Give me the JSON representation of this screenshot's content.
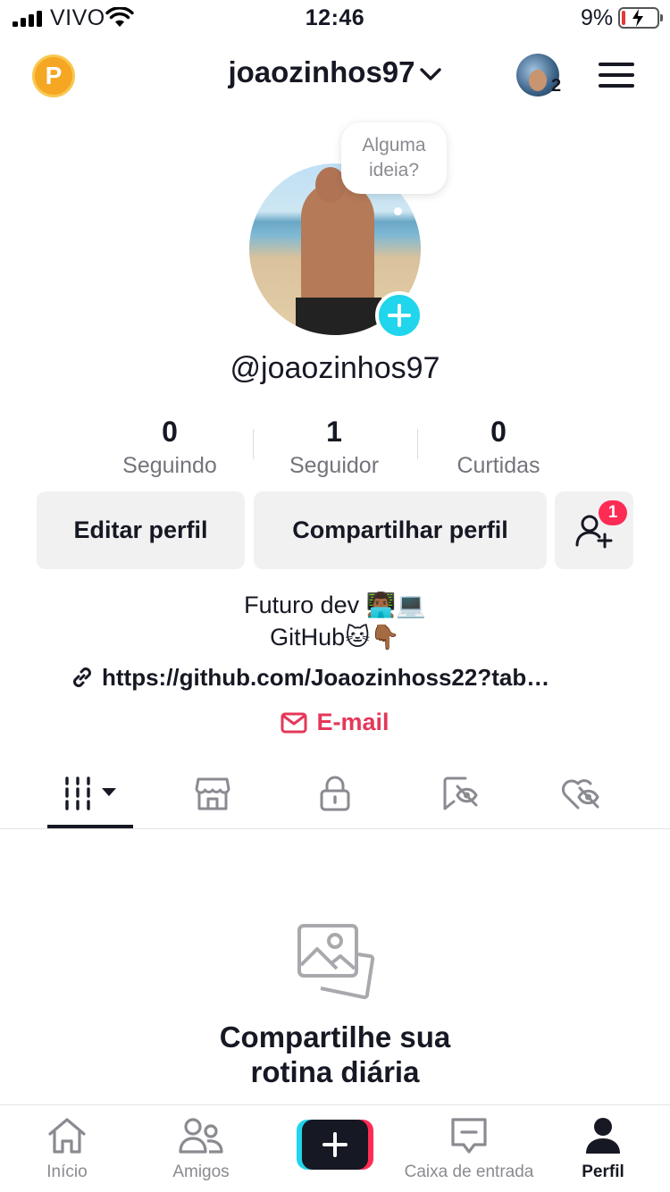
{
  "status_bar": {
    "carrier": "VIVO",
    "time": "12:46",
    "battery_percent": "9%"
  },
  "header": {
    "coin_label": "P",
    "username": "joaozinhos97",
    "story_count": "2"
  },
  "profile": {
    "bubble_text_line1": "Alguma",
    "bubble_text_line2": "ideia?",
    "handle": "@joaozinhos97",
    "stats": [
      {
        "value": "0",
        "label": "Seguindo"
      },
      {
        "value": "1",
        "label": "Seguidor"
      },
      {
        "value": "0",
        "label": "Curtidas"
      }
    ],
    "edit_button": "Editar perfil",
    "share_button": "Compartilhar perfil",
    "friend_requests_badge": "1",
    "bio_line1": "Futuro dev 👨🏾‍💻💻",
    "bio_line2": "GitHub🐱👇🏾",
    "link": "https://github.com/Joaozinhoss22?tab…",
    "email_label": "E-mail"
  },
  "tabs": [
    {
      "icon": "videos-grid-icon",
      "active": true
    },
    {
      "icon": "shop-icon",
      "active": false
    },
    {
      "icon": "lock-icon",
      "active": false
    },
    {
      "icon": "reposts-hidden-icon",
      "active": false
    },
    {
      "icon": "liked-hidden-icon",
      "active": false
    }
  ],
  "empty_state": {
    "line1": "Compartilhe sua",
    "line2": "rotina diária"
  },
  "bottom_nav": {
    "home": "Início",
    "friends": "Amigos",
    "inbox": "Caixa de entrada",
    "profile": "Perfil"
  },
  "colors": {
    "accent_red": "#fe2c55",
    "accent_cyan": "#20d5ec",
    "email_red": "#e4385a",
    "text_dark": "#161823"
  }
}
